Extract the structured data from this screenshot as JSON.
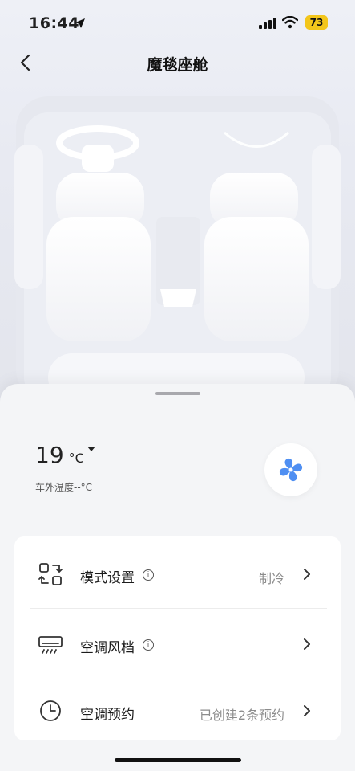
{
  "status_bar": {
    "time": "16:44",
    "battery": "73"
  },
  "header": {
    "title": "魔毯座舱"
  },
  "climate": {
    "temperature": "19",
    "unit": "°C",
    "outside_label": "车外温度--°C"
  },
  "settings": [
    {
      "label": "模式设置",
      "value": "制冷",
      "icon": "mode-switch-icon",
      "info": true
    },
    {
      "label": "空调风档",
      "value": "",
      "icon": "ac-vent-icon",
      "info": true
    },
    {
      "label": "空调预约",
      "value": "已创建2条预约",
      "icon": "clock-icon",
      "info": false
    }
  ],
  "colors": {
    "fan_blue": "#4f8ff2",
    "battery_yellow": "#f3c61b"
  }
}
